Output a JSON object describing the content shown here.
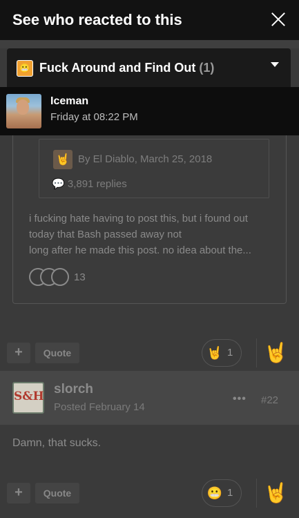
{
  "modal": {
    "title": "See who reacted to this",
    "filter": {
      "label": "Fuck Around and Find Out",
      "count": "(1)"
    },
    "reactors": [
      {
        "name": "Iceman",
        "time": "Friday at 08:22 PM"
      }
    ]
  },
  "background": {
    "quoted_topic": {
      "by": "By El Diablo, March 25, 2018",
      "replies": "3,891 replies"
    },
    "snippet_lines": [
      "i fucking hate having to post this, but i found out",
      "today that Bash passed away not",
      "long after he made this post.  no idea about the..."
    ],
    "snippet_reaction_count": "13",
    "action_bar_1": {
      "plus": "+",
      "quote": "Quote",
      "reaction_count": "1"
    },
    "post": {
      "author": "slorch",
      "avatar_text": "S&H",
      "posted": "Posted February 14",
      "more": "•••",
      "number": "#22",
      "body": "Damn, that sucks."
    },
    "action_bar_2": {
      "plus": "+",
      "quote": "Quote",
      "reaction_count": "1"
    }
  },
  "icons": {
    "close": "close-icon",
    "chevron": "chevron-down-icon",
    "horns": "rock-on-icon",
    "comment": "comment-icon"
  }
}
